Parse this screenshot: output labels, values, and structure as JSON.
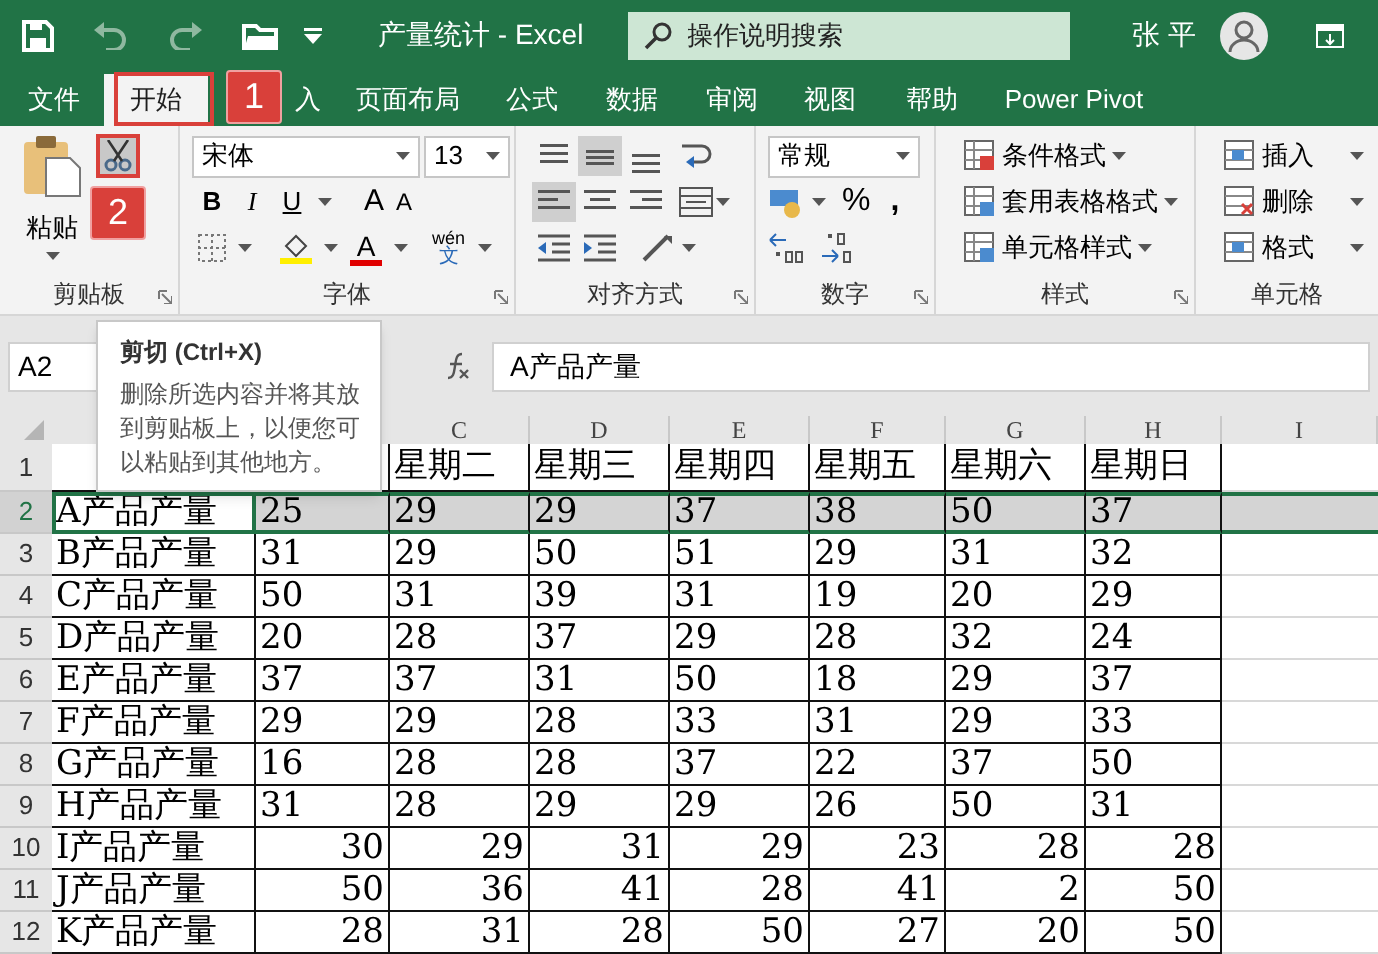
{
  "title_bar": {
    "title": "产量统计 - Excel",
    "search_placeholder": "操作说明搜索",
    "user": "张 平"
  },
  "tabs": [
    {
      "label": "文件",
      "selected": false
    },
    {
      "label": "开始",
      "selected": true
    },
    {
      "label": "入",
      "selected": false
    },
    {
      "label": "页面布局",
      "selected": false
    },
    {
      "label": "公式",
      "selected": false
    },
    {
      "label": "数据",
      "selected": false
    },
    {
      "label": "审阅",
      "selected": false
    },
    {
      "label": "视图",
      "selected": false
    },
    {
      "label": "帮助",
      "selected": false
    },
    {
      "label": "Power Pivot",
      "selected": false
    }
  ],
  "annotations": [
    {
      "label": "1"
    },
    {
      "label": "2"
    }
  ],
  "ribbon": {
    "clipboard": {
      "paste": "粘贴",
      "label": "剪贴板"
    },
    "font": {
      "name": "宋体",
      "size": "13",
      "bold": "B",
      "italic": "I",
      "underline": "U",
      "grow": "A",
      "shrink": "A",
      "font_color": "A",
      "phonetic": "wén",
      "phonetic_char": "文",
      "label": "字体"
    },
    "alignment": {
      "label": "对齐方式"
    },
    "number": {
      "format": "常规",
      "percent": "%",
      "comma": ",",
      "label": "数字"
    },
    "styles": {
      "items": [
        "条件格式",
        "套用表格格式",
        "单元格样式"
      ],
      "label": "样式"
    },
    "cells": {
      "items": [
        "插入",
        "删除",
        "格式"
      ],
      "label": "单元格"
    }
  },
  "formula_bar": {
    "name_box": "A2",
    "value": "A产品产量"
  },
  "tooltip": {
    "title": "剪切 (Ctrl+X)",
    "body": "删除所选内容并将其放到剪贴板上，以便您可以粘贴到其他地方。"
  },
  "sheet": {
    "columns": [
      null,
      null,
      "C",
      "D",
      "E",
      "F",
      "G",
      "H",
      "I"
    ],
    "rows": [
      {
        "number": "1",
        "selected": false,
        "kind": "text",
        "cells": [
          null,
          null,
          "星期二",
          "星期三",
          "星期四",
          "星期五",
          "星期六",
          "星期日"
        ]
      },
      {
        "number": "2",
        "selected": true,
        "kind": "text",
        "cells": [
          "A产品产量",
          "25",
          "29",
          "29",
          "37",
          "38",
          "50",
          "37"
        ]
      },
      {
        "number": "3",
        "selected": false,
        "kind": "text",
        "cells": [
          "B产品产量",
          "31",
          "29",
          "50",
          "51",
          "29",
          "31",
          "32"
        ]
      },
      {
        "number": "4",
        "selected": false,
        "kind": "text",
        "cells": [
          "C产品产量",
          "50",
          "31",
          "39",
          "31",
          "19",
          "20",
          "29"
        ]
      },
      {
        "number": "5",
        "selected": false,
        "kind": "text",
        "cells": [
          "D产品产量",
          "20",
          "28",
          "37",
          "29",
          "28",
          "32",
          "24"
        ]
      },
      {
        "number": "6",
        "selected": false,
        "kind": "text",
        "cells": [
          "E产品产量",
          "37",
          "37",
          "31",
          "50",
          "18",
          "29",
          "37"
        ]
      },
      {
        "number": "7",
        "selected": false,
        "kind": "text",
        "cells": [
          "F产品产量",
          "29",
          "29",
          "28",
          "33",
          "31",
          "29",
          "33"
        ]
      },
      {
        "number": "8",
        "selected": false,
        "kind": "text",
        "cells": [
          "G产品产量",
          "16",
          "28",
          "28",
          "37",
          "22",
          "37",
          "50"
        ]
      },
      {
        "number": "9",
        "selected": false,
        "kind": "text",
        "cells": [
          "H产品产量",
          "31",
          "28",
          "29",
          "29",
          "26",
          "50",
          "31"
        ]
      },
      {
        "number": "10",
        "selected": false,
        "kind": "number",
        "cells": [
          "I产品产量",
          "30",
          "29",
          "31",
          "29",
          "23",
          "28",
          "28"
        ]
      },
      {
        "number": "11",
        "selected": false,
        "kind": "number",
        "cells": [
          "J产品产量",
          "50",
          "36",
          "41",
          "28",
          "41",
          "2",
          "50"
        ]
      },
      {
        "number": "12",
        "selected": false,
        "kind": "number",
        "cells": [
          "K产品产量",
          "28",
          "31",
          "28",
          "50",
          "27",
          "20",
          "50"
        ]
      }
    ]
  }
}
